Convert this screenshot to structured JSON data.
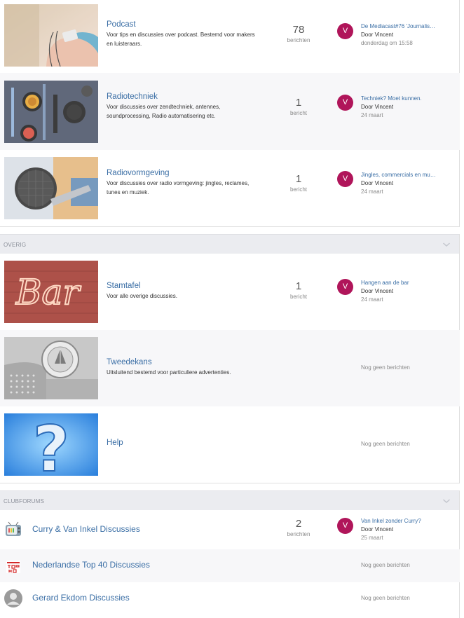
{
  "forums": [
    {
      "title": "Podcast",
      "desc": "Voor tips en discussies over podcast. Bestemd voor makers en luisteraars.",
      "count": "78",
      "count_label": "berichten",
      "avatar_letter": "V",
      "last_title": "De Mediacast#76 'Journalis…",
      "last_by": "Door Vincent",
      "last_date": "donderdag om 15:58"
    },
    {
      "title": "Radiotechniek",
      "desc": "Voor discussies over zendtechniek, antennes, soundprocessing, Radio automatisering etc.",
      "count": "1",
      "count_label": "bericht",
      "avatar_letter": "V",
      "last_title": "Techniek? Moet kunnen.",
      "last_by": "Door Vincent",
      "last_date": "24 maart"
    },
    {
      "title": "Radiovormgeving",
      "desc": "Voor discussies over radio vormgeving: jingles, reclames, tunes en muziek.",
      "count": "1",
      "count_label": "bericht",
      "avatar_letter": "V",
      "last_title": "Jingles, commercials en mu…",
      "last_by": "Door Vincent",
      "last_date": "24 maart"
    }
  ],
  "overig": {
    "header": "OVERIG",
    "forums": [
      {
        "title": "Stamtafel",
        "desc": "Voor alle overige discussies.",
        "count": "1",
        "count_label": "bericht",
        "avatar_letter": "V",
        "last_title": "Hangen aan de bar",
        "last_by": "Door Vincent",
        "last_date": "24 maart",
        "thumb_text": "Bar"
      },
      {
        "title": "Tweedekans",
        "desc": "Uitsluitend bestemd voor particuliere advertenties.",
        "none": "Nog geen berichten"
      },
      {
        "title": "Help",
        "none": "Nog geen berichten",
        "thumb_text": "?"
      }
    ]
  },
  "club": {
    "header": "CLUBFORUMS",
    "forums": [
      {
        "title": "Curry & Van Inkel Discussies",
        "count": "2",
        "count_label": "berichten",
        "avatar_letter": "V",
        "last_title": "Van Inkel zonder Curry?",
        "last_by": "Door Vincent",
        "last_date": "25 maart"
      },
      {
        "title": "Nederlandse Top 40 Discussies",
        "none": "Nog geen berichten"
      },
      {
        "title": "Gerard Ekdom Discussies",
        "none": "Nog geen berichten"
      }
    ]
  },
  "colors": {
    "link": "#3a6ea5",
    "avatar": "#b0155a",
    "header_bg": "#ebecf0",
    "alt_row": "#f7f7f9"
  },
  "icons": {
    "chevron": "chevron-down-icon",
    "tv": "tv-icon",
    "top40": "top40-logo-icon",
    "user": "user-silhouette-icon"
  }
}
